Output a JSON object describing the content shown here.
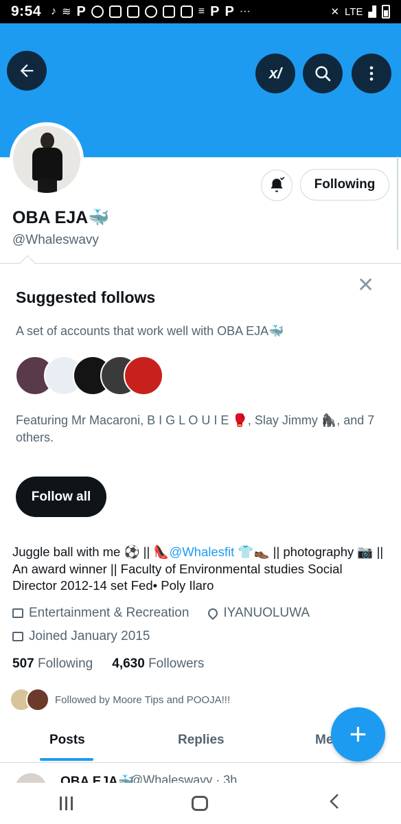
{
  "status_bar": {
    "time": "9:54",
    "network": "LTE",
    "more": "···"
  },
  "header": {
    "back_icon": "arrow-left-icon",
    "grok_label": "x/",
    "search_icon": "search-icon",
    "more_icon": "more-vertical-icon"
  },
  "profile": {
    "name": "OBA EJA🐳",
    "handle": "@Whaleswavy",
    "following_button": "Following"
  },
  "suggested": {
    "title": "Suggested follows",
    "description": "A set of accounts that work well with OBA EJA🐳",
    "featuring": "Featuring Mr Macaroni, B I G L O U I E 🥊, Slay Jimmy 🦍, and 7 others.",
    "follow_all": "Follow all",
    "close": "✕"
  },
  "bio": {
    "text_before": "Juggle ball with me ⚽ || 👠",
    "mention": "@Whalesfit",
    "text_after": " 👕👞 || photography 📷 || An award winner || Faculty of Environmental studies Social Director 2012-14 set Fed• Poly Ilaro",
    "category": "Entertainment & Recreation",
    "location": "IYANUOLUWA",
    "joined": "Joined January 2015"
  },
  "counts": {
    "following_count": "507",
    "following_label": "Following",
    "followers_count": "4,630",
    "followers_label": "Followers"
  },
  "followed_by": "Followed by Moore Tips and POOJA!!!",
  "tabs": [
    "Posts",
    "Replies",
    "Me"
  ],
  "fab": "+",
  "post_peek": {
    "name": "OBA EJA🐳",
    "handle": "@Whaleswavy · 3h"
  },
  "colors": {
    "accent": "#1d9bf0",
    "text": "#0f1419",
    "muted": "#536471"
  }
}
